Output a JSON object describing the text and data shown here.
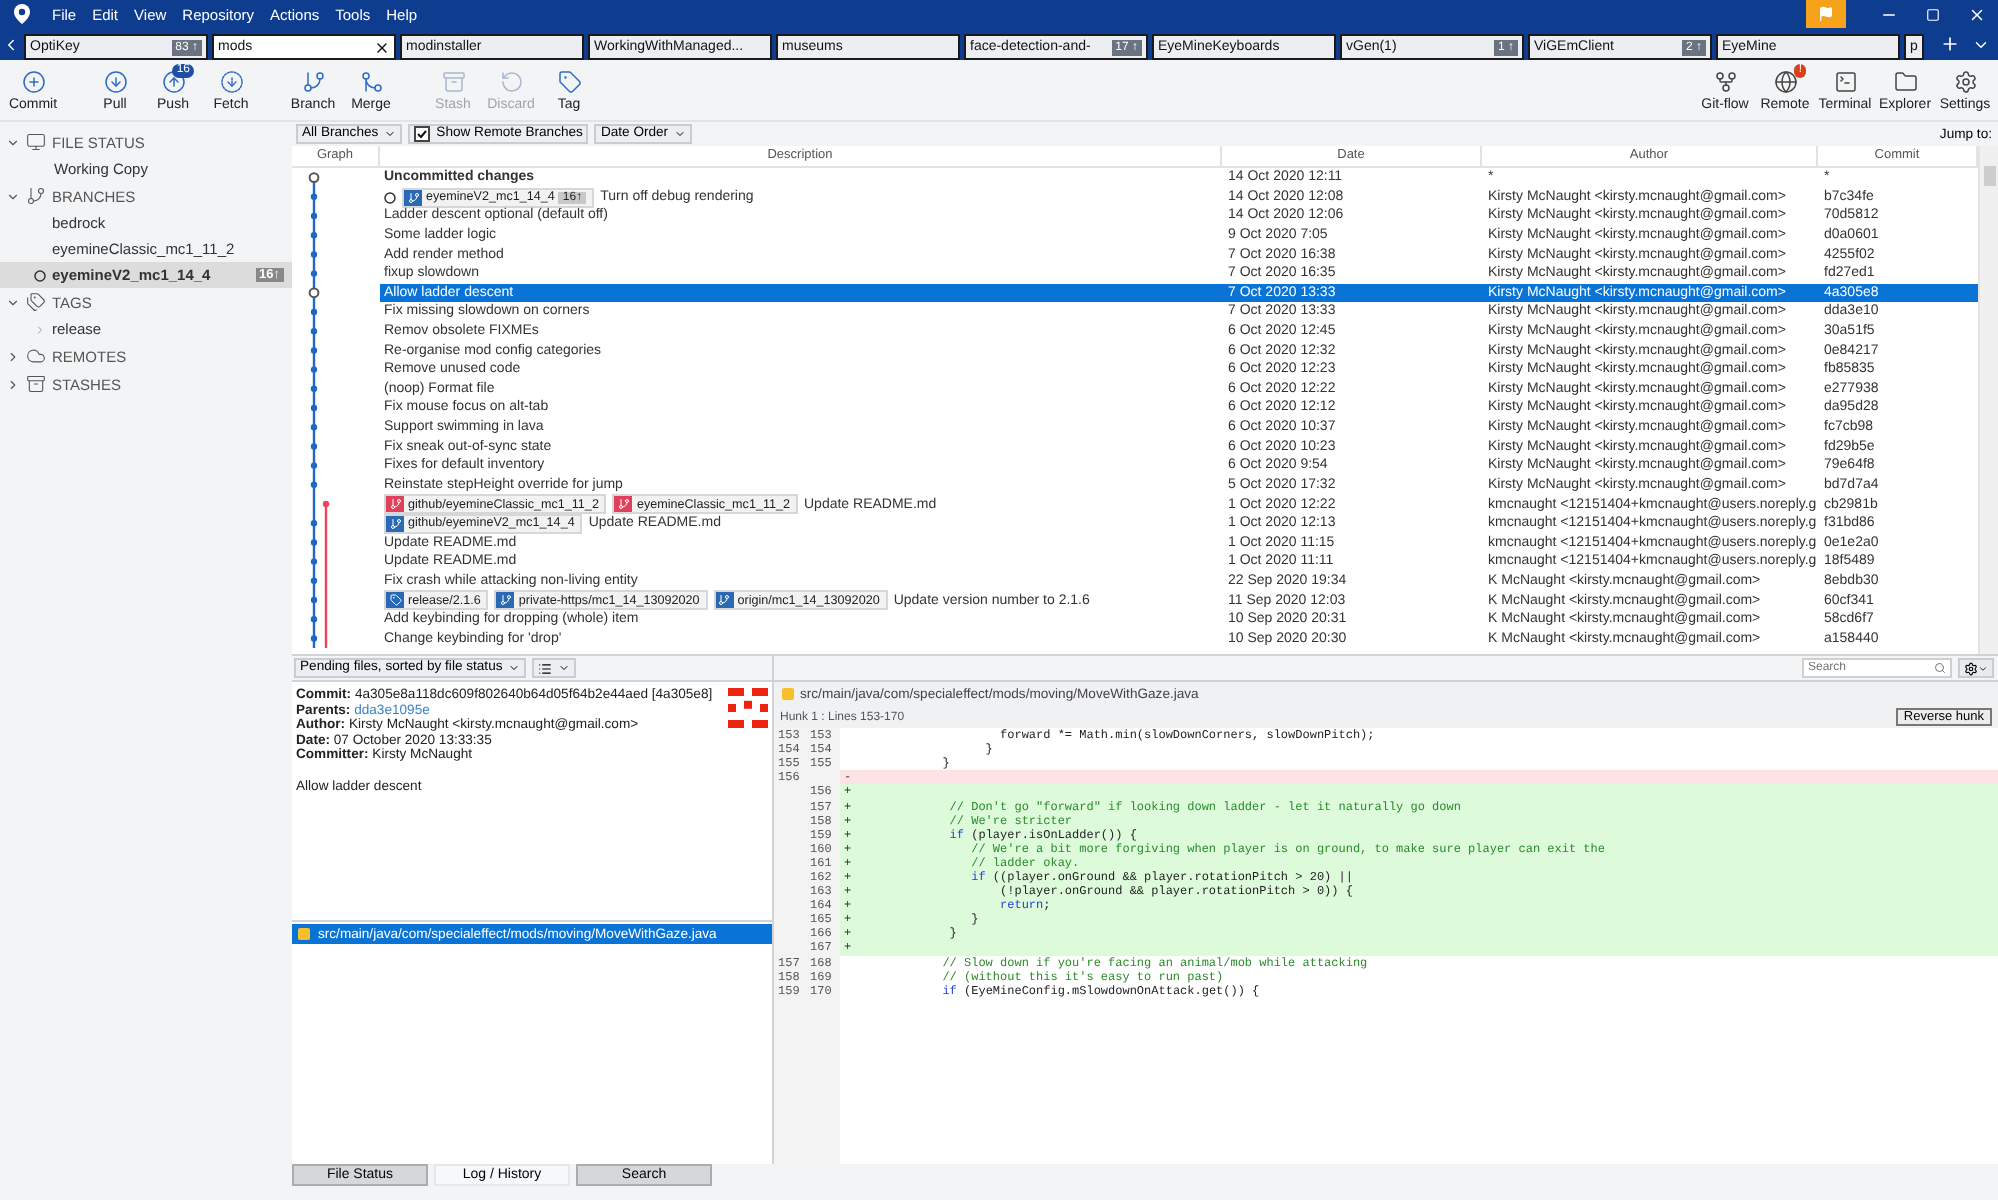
{
  "menu": [
    "File",
    "Edit",
    "View",
    "Repository",
    "Actions",
    "Tools",
    "Help"
  ],
  "tabs": [
    {
      "label": "OptiKey",
      "badge": "83 ↑",
      "selected": false
    },
    {
      "label": "mods",
      "selected": true
    },
    {
      "label": "modinstaller",
      "selected": false
    },
    {
      "label": "WorkingWithManaged...",
      "selected": false
    },
    {
      "label": "museums",
      "selected": false
    },
    {
      "label": "face-detection-and-",
      "badge": "17 ↑",
      "selected": false
    },
    {
      "label": "EyeMineKeyboards",
      "selected": false
    },
    {
      "label": "vGen(1)",
      "badge": "1 ↑",
      "selected": false
    },
    {
      "label": "ViGEmClient",
      "badge": "2 ↑",
      "selected": false
    },
    {
      "label": "EyeMine",
      "selected": false
    },
    {
      "label": "p",
      "selected": false
    }
  ],
  "toolbar": {
    "groups": [
      {
        "items": [
          {
            "kind": "commit",
            "label": "Commit",
            "disabled": false
          }
        ]
      },
      {
        "items": [
          {
            "kind": "pull",
            "label": "Pull",
            "disabled": false
          },
          {
            "kind": "push",
            "label": "Push",
            "badge": "16",
            "disabled": false
          },
          {
            "kind": "fetch",
            "label": "Fetch",
            "disabled": false
          }
        ]
      },
      {
        "items": [
          {
            "kind": "branch",
            "label": "Branch",
            "disabled": false
          },
          {
            "kind": "merge",
            "label": "Merge",
            "disabled": false
          }
        ]
      },
      {
        "items": [
          {
            "kind": "stash",
            "label": "Stash",
            "disabled": true
          },
          {
            "kind": "discard",
            "label": "Discard",
            "disabled": true
          },
          {
            "kind": "tag",
            "label": "Tag",
            "disabled": false
          }
        ]
      }
    ],
    "right": [
      {
        "kind": "gitflow",
        "label": "Git-flow",
        "disabled": false
      },
      {
        "kind": "remote",
        "label": "Remote",
        "badge": "!",
        "disabled": false
      },
      {
        "kind": "terminal",
        "label": "Terminal",
        "disabled": false
      },
      {
        "kind": "explorer",
        "label": "Explorer",
        "disabled": false
      },
      {
        "kind": "settings",
        "label": "Settings",
        "disabled": false
      }
    ]
  },
  "sidebar": [
    {
      "kind": "file_status",
      "title": "FILE STATUS",
      "expanded": true,
      "items": [
        {
          "label": "Working Copy",
          "selected": false
        }
      ]
    },
    {
      "kind": "branches",
      "title": "BRANCHES",
      "expanded": true,
      "items": [
        {
          "label": "bedrock",
          "selected": false,
          "current": false
        },
        {
          "label": "eyemineClassic_mc1_11_2",
          "selected": false,
          "current": false
        },
        {
          "label": "eyemineV2_mc1_14_4",
          "badge": "16↑",
          "selected": true,
          "current": true
        }
      ]
    },
    {
      "kind": "tags",
      "title": "TAGS",
      "expanded": true,
      "items": [
        {
          "label": "release",
          "selected": false,
          "expanded": false
        }
      ]
    },
    {
      "kind": "remotes",
      "title": "REMOTES",
      "expanded": false
    },
    {
      "kind": "stashes",
      "title": "STASHES",
      "expanded": false
    }
  ],
  "filters": {
    "branches": "All Branches",
    "show_remote": {
      "label": "Show Remote Branches",
      "checked": true
    },
    "order": "Date Order",
    "jump": "Jump to:"
  },
  "log": {
    "columns": [
      "Graph",
      "Description",
      "Date",
      "Author",
      "Commit"
    ],
    "rows": [
      {
        "kind": "uncommitted",
        "description": "Uncommitted changes",
        "date": "14 Oct 2020 12:11",
        "author": "*",
        "commit": "*",
        "selected": false,
        "head": false
      },
      {
        "kind": "commit",
        "refs": [
          {
            "kind": "branch",
            "name": "eyemineV2_mc1_14_4",
            "count": "16↑",
            "color": "#2a69b3"
          }
        ],
        "description": "Turn off debug rendering",
        "date": "14 Oct 2020 12:08",
        "author": "Kirsty McNaught <kirsty.mcnaught@gmail.com>",
        "commit": "b7c34fe",
        "selected": false,
        "head": true
      },
      {
        "kind": "commit",
        "description": "Ladder descent optional (default off)",
        "date": "14 Oct 2020 12:06",
        "author": "Kirsty McNaught <kirsty.mcnaught@gmail.com>",
        "commit": "70d5812",
        "selected": false,
        "head": false
      },
      {
        "kind": "commit",
        "description": "Some ladder logic",
        "date": "9 Oct 2020 7:05",
        "author": "Kirsty McNaught <kirsty.mcnaught@gmail.com>",
        "commit": "d0a0601",
        "selected": false,
        "head": false
      },
      {
        "kind": "commit",
        "description": "Add render method",
        "date": "7 Oct 2020 16:38",
        "author": "Kirsty McNaught <kirsty.mcnaught@gmail.com>",
        "commit": "4255f02",
        "selected": false,
        "head": false
      },
      {
        "kind": "commit",
        "description": "fixup slowdown",
        "date": "7 Oct 2020 16:35",
        "author": "Kirsty McNaught <kirsty.mcnaught@gmail.com>",
        "commit": "fd27ed1",
        "selected": false,
        "head": false
      },
      {
        "kind": "commit",
        "description": "Allow ladder descent",
        "date": "7 Oct 2020 13:33",
        "author": "Kirsty McNaught <kirsty.mcnaught@gmail.com>",
        "commit": "4a305e8",
        "selected": true,
        "head": false
      },
      {
        "kind": "commit",
        "description": "Fix missing slowdown on corners",
        "date": "7 Oct 2020 13:33",
        "author": "Kirsty McNaught <kirsty.mcnaught@gmail.com>",
        "commit": "dda3e10",
        "selected": false,
        "head": false
      },
      {
        "kind": "commit",
        "description": "Remov obsolete FIXMEs",
        "date": "6 Oct 2020 12:45",
        "author": "Kirsty McNaught <kirsty.mcnaught@gmail.com>",
        "commit": "30a51f5",
        "selected": false,
        "head": false
      },
      {
        "kind": "commit",
        "description": "Re-organise mod config categories",
        "date": "6 Oct 2020 12:32",
        "author": "Kirsty McNaught <kirsty.mcnaught@gmail.com>",
        "commit": "0e84217",
        "selected": false,
        "head": false
      },
      {
        "kind": "commit",
        "description": "Remove unused code",
        "date": "6 Oct 2020 12:23",
        "author": "Kirsty McNaught <kirsty.mcnaught@gmail.com>",
        "commit": "fb85835",
        "selected": false,
        "head": false
      },
      {
        "kind": "commit",
        "description": "(noop) Format file",
        "date": "6 Oct 2020 12:22",
        "author": "Kirsty McNaught <kirsty.mcnaught@gmail.com>",
        "commit": "e277938",
        "selected": false,
        "head": false
      },
      {
        "kind": "commit",
        "description": "Fix mouse focus on alt-tab",
        "date": "6 Oct 2020 12:12",
        "author": "Kirsty McNaught <kirsty.mcnaught@gmail.com>",
        "commit": "da95d28",
        "selected": false,
        "head": false
      },
      {
        "kind": "commit",
        "description": "Support swimming in lava",
        "date": "6 Oct 2020 10:37",
        "author": "Kirsty McNaught <kirsty.mcnaught@gmail.com>",
        "commit": "fc7cb98",
        "selected": false,
        "head": false
      },
      {
        "kind": "commit",
        "description": "Fix sneak out-of-sync state",
        "date": "6 Oct 2020 10:23",
        "author": "Kirsty McNaught <kirsty.mcnaught@gmail.com>",
        "commit": "fd29b5e",
        "selected": false,
        "head": false
      },
      {
        "kind": "commit",
        "description": "Fixes for default inventory",
        "date": "6 Oct 2020 9:54",
        "author": "Kirsty McNaught <kirsty.mcnaught@gmail.com>",
        "commit": "79e64f8",
        "selected": false,
        "head": false
      },
      {
        "kind": "commit",
        "description": "Reinstate stepHeight override for jump",
        "date": "5 Oct 2020 17:32",
        "author": "Kirsty McNaught <kirsty.mcnaught@gmail.com>",
        "commit": "bd7d7a4",
        "selected": false,
        "head": false
      },
      {
        "kind": "commit",
        "refs": [
          {
            "kind": "branch",
            "name": "github/eyemineClassic_mc1_11_2",
            "color": "#e0405a"
          },
          {
            "kind": "branch",
            "name": "eyemineClassic_mc1_11_2",
            "color": "#e0405a"
          }
        ],
        "description": "Update README.md",
        "date": "1 Oct 2020 12:22",
        "author": "kmcnaught <12151404+kmcnaught@users.noreply.g",
        "commit": "cb2981b",
        "selected": false,
        "head": false
      },
      {
        "kind": "commit",
        "refs": [
          {
            "kind": "branch",
            "name": "github/eyemineV2_mc1_14_4",
            "color": "#2a69b3"
          }
        ],
        "description": "Update README.md",
        "date": "1 Oct 2020 12:13",
        "author": "kmcnaught <12151404+kmcnaught@users.noreply.g",
        "commit": "f31bd86",
        "selected": false,
        "head": false
      },
      {
        "kind": "commit",
        "description": "Update README.md",
        "date": "1 Oct 2020 11:15",
        "author": "kmcnaught <12151404+kmcnaught@users.noreply.g",
        "commit": "0e1e2a0",
        "selected": false,
        "head": false
      },
      {
        "kind": "commit",
        "description": "Update README.md",
        "date": "1 Oct 2020 11:11",
        "author": "kmcnaught <12151404+kmcnaught@users.noreply.g",
        "commit": "18f5489",
        "selected": false,
        "head": false
      },
      {
        "kind": "commit",
        "description": "Fix crash while attacking non-living entity",
        "date": "22 Sep 2020 19:34",
        "author": "K McNaught <kirsty.mcnaught@gmail.com>",
        "commit": "8ebdb30",
        "selected": false,
        "head": false
      },
      {
        "kind": "commit",
        "refs": [
          {
            "kind": "tag",
            "name": "release/2.1.6",
            "color": "#2a69b3"
          },
          {
            "kind": "branch",
            "name": "private-https/mc1_14_13092020",
            "color": "#2a69b3"
          },
          {
            "kind": "branch",
            "name": "origin/mc1_14_13092020",
            "color": "#2a69b3"
          }
        ],
        "description": "Update version number to 2.1.6",
        "date": "11 Sep 2020 12:03",
        "author": "K McNaught <kirsty.mcnaught@gmail.com>",
        "commit": "60cf341",
        "selected": false,
        "head": false
      },
      {
        "kind": "commit",
        "description": "Add keybinding for dropping (whole) item",
        "date": "10 Sep 2020 20:31",
        "author": "K McNaught <kirsty.mcnaught@gmail.com>",
        "commit": "58cd6f7",
        "selected": false,
        "head": false
      },
      {
        "kind": "commit",
        "description": "Change keybinding for 'drop'",
        "date": "10 Sep 2020 20:30",
        "author": "K McNaught <kirsty.mcnaught@gmail.com>",
        "commit": "a158440",
        "selected": false,
        "head": false
      }
    ]
  },
  "files_pane": {
    "sort": "Pending files, sorted by file status",
    "details": {
      "commit_label": "Commit:",
      "commit": "4a305e8a118dc609f802640b64d05f64b2e44aed [4a305e8]",
      "parents_label": "Parents:",
      "parents": "dda3e1095e",
      "author_label": "Author:",
      "author": "Kirsty McNaught <kirsty.mcnaught@gmail.com>",
      "date_label": "Date:",
      "date": "07 October 2020 13:33:35",
      "committer_label": "Committer:",
      "committer": "Kirsty McNaught",
      "message": "Allow ladder descent"
    },
    "files": [
      {
        "path": "src/main/java/com/specialeffect/mods/moving/MoveWithGaze.java",
        "selected": true
      }
    ]
  },
  "diff": {
    "search_placeholder": "Search",
    "file": "src/main/java/com/specialeffect/mods/moving/MoveWithGaze.java",
    "hunk": "Hunk 1 : Lines 153-170",
    "reverse": "Reverse hunk",
    "lines": [
      {
        "kind": "context",
        "old": "153",
        "new": "153",
        "segments": [
          {
            "text": "                    forward *= Math.min(slowDownCorners, slowDownPitch);",
            "kind": "plain"
          }
        ]
      },
      {
        "kind": "context",
        "old": "154",
        "new": "154",
        "segments": [
          {
            "text": "                  }",
            "kind": "plain"
          }
        ]
      },
      {
        "kind": "context",
        "old": "155",
        "new": "155",
        "segments": [
          {
            "text": "            }",
            "kind": "plain"
          }
        ]
      },
      {
        "kind": "removed",
        "old": "156",
        "marker": "-"
      },
      {
        "kind": "added",
        "new": "156",
        "marker": "+"
      },
      {
        "kind": "added",
        "new": "157",
        "marker": "+",
        "segments": [
          {
            "text": "             // Don't go \"forward\" if looking down ladder - let it naturally go down",
            "kind": "comment"
          }
        ]
      },
      {
        "kind": "added",
        "new": "158",
        "marker": "+",
        "segments": [
          {
            "text": "             // We're stricter",
            "kind": "comment"
          }
        ]
      },
      {
        "kind": "added",
        "new": "159",
        "marker": "+",
        "segments": [
          {
            "text": "             if",
            "kind": "keyword"
          },
          {
            "text": " (player.isOnLadder()) {",
            "kind": "plain"
          }
        ]
      },
      {
        "kind": "added",
        "new": "160",
        "marker": "+",
        "segments": [
          {
            "text": "                // We're a bit more forgiving when player is on ground, to make sure player can exit the",
            "kind": "comment"
          }
        ]
      },
      {
        "kind": "added",
        "new": "161",
        "marker": "+",
        "segments": [
          {
            "text": "                // ladder okay.",
            "kind": "comment"
          }
        ]
      },
      {
        "kind": "added",
        "new": "162",
        "marker": "+",
        "segments": [
          {
            "text": "                if",
            "kind": "keyword"
          },
          {
            "text": " ((player.onGround && player.rotationPitch > 20) ||",
            "kind": "plain"
          }
        ]
      },
      {
        "kind": "added",
        "new": "163",
        "marker": "+",
        "segments": [
          {
            "text": "                    (!player.onGround && player.rotationPitch > 0)) {",
            "kind": "plain"
          }
        ]
      },
      {
        "kind": "added",
        "new": "164",
        "marker": "+",
        "segments": [
          {
            "text": "                    return",
            "kind": "keyword"
          },
          {
            "text": ";",
            "kind": "plain"
          }
        ]
      },
      {
        "kind": "added",
        "new": "165",
        "marker": "+",
        "segments": [
          {
            "text": "                }",
            "kind": "plain"
          }
        ]
      },
      {
        "kind": "added",
        "new": "166",
        "marker": "+",
        "segments": [
          {
            "text": "             }",
            "kind": "plain"
          }
        ]
      },
      {
        "kind": "added",
        "new": "167",
        "marker": "+"
      },
      {
        "kind": "context",
        "old": "157",
        "new": "168",
        "segments": [
          {
            "text": "            // Slow down if you're facing an animal/mob while attacking",
            "kind": "comment"
          }
        ]
      },
      {
        "kind": "context",
        "old": "158",
        "new": "169",
        "segments": [
          {
            "text": "            // (without this it's easy to run past)",
            "kind": "comment"
          }
        ]
      },
      {
        "kind": "context",
        "old": "159",
        "new": "170",
        "segments": [
          {
            "text": "            if",
            "kind": "keyword"
          },
          {
            "text": " (EyeMineConfig.mSlowdownOnAttack.get()) {",
            "kind": "plain"
          }
        ]
      }
    ]
  },
  "bottom_tabs": [
    {
      "label": "File Status",
      "selected": false
    },
    {
      "label": "Log / History",
      "selected": true
    },
    {
      "label": "Search",
      "selected": false
    }
  ]
}
